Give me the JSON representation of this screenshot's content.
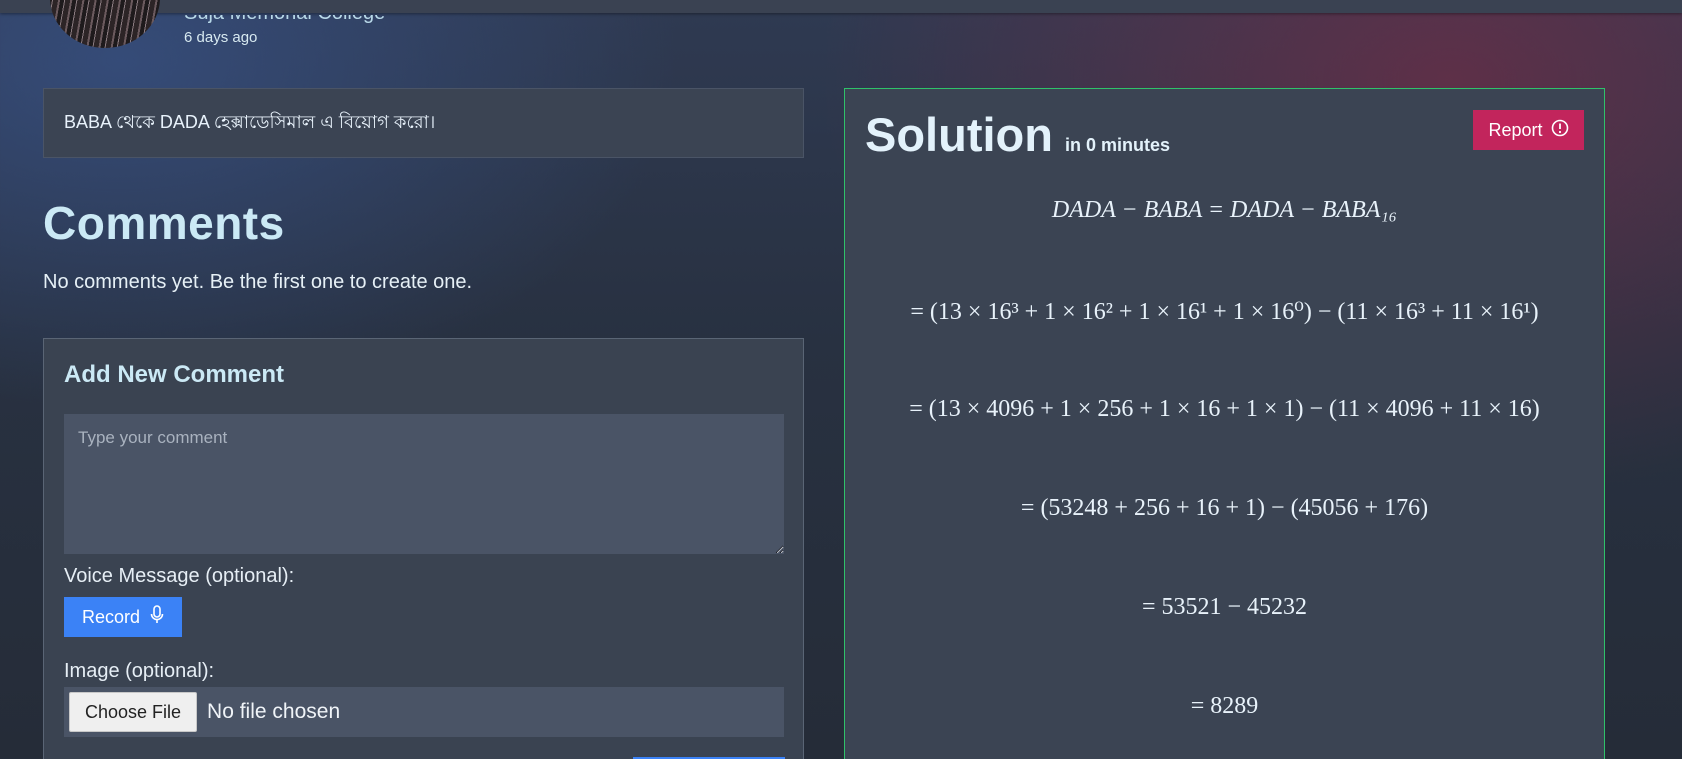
{
  "poster": {
    "name": "Suja Memorial College",
    "time": "6 days ago"
  },
  "question": {
    "text": "BABA থেকে DADA হেক্সাডেসিমাল এ বিয়োগ করো।"
  },
  "comments": {
    "title": "Comments",
    "empty_text": "No comments yet. Be the first one to create one."
  },
  "add_comment": {
    "title": "Add New Comment",
    "textarea_placeholder": "Type your comment",
    "voice_label": "Voice Message (optional):",
    "record_label": "Record",
    "image_label": "Image (optional):",
    "choose_file_label": "Choose File",
    "file_status": "No file chosen"
  },
  "solution": {
    "title": "Solution",
    "subtitle": "in 0 minutes",
    "report_label": "Report",
    "lines": [
      "DADA − BABA = DADA − BABA₁₆",
      "= (13 × 16³ + 1 × 16² + 1 × 16¹ + 1 × 16⁰) − (11 × 16³ + 11 × 16¹)",
      "= (13 × 4096 + 1 × 256 + 1 × 16 + 1 × 1) − (11 × 4096 + 11 × 16)",
      "= (53248 + 256 + 16 + 1) − (45056 + 176)",
      "= 53521 − 45232",
      "= 8289"
    ]
  },
  "colors": {
    "accent_blue": "#3b82f6",
    "report_red": "#c2255c",
    "solution_border": "#2fc26a"
  },
  "icons": {
    "record": "microphone-icon",
    "report": "alert-circle-icon"
  }
}
